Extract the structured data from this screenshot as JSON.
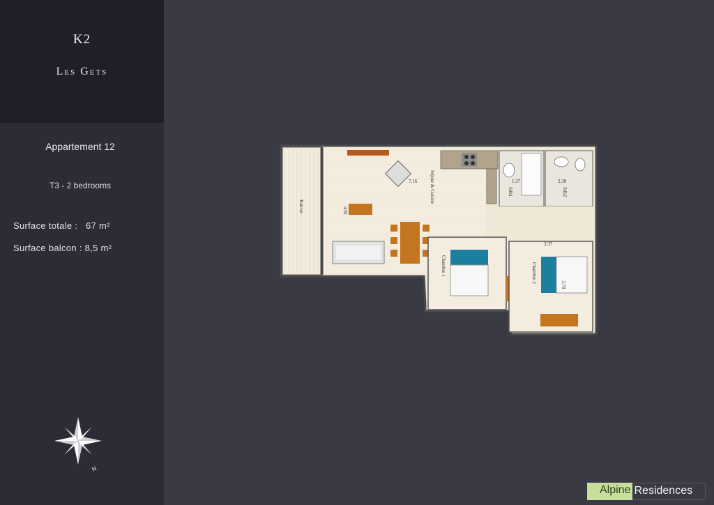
{
  "brand": {
    "code": "K2",
    "place": "Les Gets"
  },
  "apartment": {
    "title": "Appartement 12",
    "type": "T3 - 2 bedrooms",
    "surface_total": "Surface totale :   67 m²",
    "surface_balcon": "Surface balcon : 8,5 m²"
  },
  "plan": {
    "rooms": {
      "balcon": "Balcon",
      "sejour": "Séjour & Cuisine",
      "sdb1": "Sdb1",
      "sdb2": "Sdb2",
      "chambre1": "Chambre 1",
      "chambre2": "Chambre 2"
    },
    "dimensions": {
      "d716": "7.16",
      "d491": "4.91",
      "d137": "1.37",
      "d230": "2.30",
      "d337": "3.37",
      "d378": "3.78"
    }
  },
  "logo": {
    "part1": "Alpine",
    "part2": "Residences",
    "accent_color": "#c6df9a"
  },
  "icons": {
    "compass": "compass-rose-icon"
  }
}
